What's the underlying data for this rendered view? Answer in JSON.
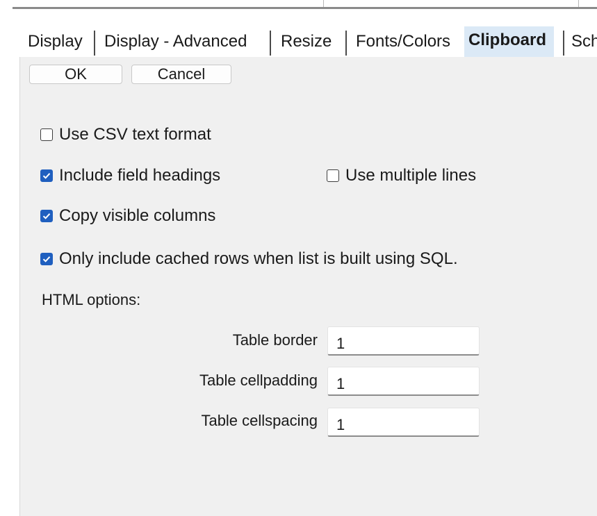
{
  "tabs": [
    {
      "label": "Display",
      "active": false
    },
    {
      "label": "Display - Advanced",
      "active": false
    },
    {
      "label": "Resize",
      "active": false
    },
    {
      "label": "Fonts/Colors",
      "active": false
    },
    {
      "label": "Clipboard",
      "active": true
    },
    {
      "label": "Sch",
      "active": false
    }
  ],
  "buttons": {
    "ok_label": "OK",
    "cancel_label": "Cancel"
  },
  "options": {
    "csv": {
      "label": "Use CSV text format",
      "checked": false
    },
    "headings": {
      "label": "Include field headings",
      "checked": true
    },
    "multiline": {
      "label": "Use multiple lines",
      "checked": false
    },
    "visible_columns": {
      "label": "Copy visible columns",
      "checked": true
    },
    "cached_rows": {
      "label": "Only include cached rows when list is built using SQL.",
      "checked": true
    }
  },
  "html_options": {
    "heading": "HTML options:",
    "table_border": {
      "label": "Table border",
      "value": "1"
    },
    "table_cellpadding": {
      "label": "Table cellpadding",
      "value": "1"
    },
    "table_cellspacing": {
      "label": "Table cellspacing",
      "value": "1"
    }
  },
  "colors": {
    "active_tab_bg": "#dbe9f6",
    "checkbox_accent": "#1f5fbf",
    "panel_bg": "#f0f0f0"
  },
  "icons": {
    "checkmark": "check-icon"
  }
}
